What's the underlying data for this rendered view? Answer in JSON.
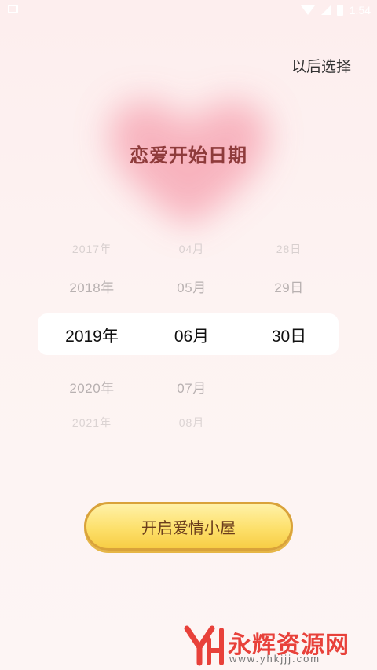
{
  "status_bar": {
    "time": "1:54",
    "icons": [
      "notification-icon",
      "wifi-icon",
      "signal-icon",
      "battery-icon"
    ]
  },
  "header": {
    "skip_label": "以后选择"
  },
  "title": "恋爱开始日期",
  "picker": {
    "years": [
      "2017年",
      "2018年",
      "2019年",
      "2020年",
      "2021年"
    ],
    "months": [
      "04月",
      "05月",
      "06月",
      "07月",
      "08月"
    ],
    "days": [
      "28日",
      "29日",
      "30日",
      "",
      ""
    ],
    "selected": {
      "year": "2019年",
      "month": "06月",
      "day": "30日"
    }
  },
  "cta": {
    "label": "开启爱情小屋"
  },
  "watermark": {
    "logo_text": "YH",
    "name": "永辉资源网",
    "url": "www.yhkjjj.com"
  },
  "colors": {
    "background": "#fdf1f0",
    "heart_glow": "#f7a9b6",
    "title": "#8e3b3b",
    "button_fill": "#fde06b",
    "button_border": "#d9a23a",
    "watermark_red": "#e8413a"
  }
}
